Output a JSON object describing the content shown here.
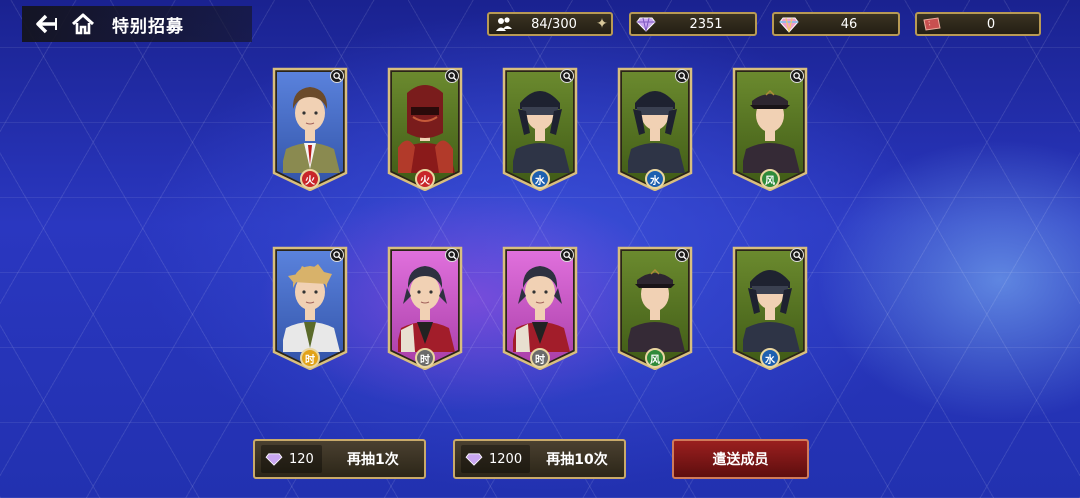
{
  "header": {
    "title": "特别招募"
  },
  "resources": [
    {
      "icon": "party-members-icon",
      "value": "84/300"
    },
    {
      "icon": "gem-icon",
      "value": "2351"
    },
    {
      "icon": "rainbow-gem-icon",
      "value": "46"
    },
    {
      "icon": "ticket-icon",
      "value": "0"
    }
  ],
  "cards": [
    {
      "element": "火",
      "bg": "blue",
      "badge_color": "#c8262a",
      "hair": "#6b4a2a",
      "outfit": "#8a8a50",
      "type": "officer"
    },
    {
      "element": "火",
      "bg": "green",
      "badge_color": "#c8262a",
      "hair": "#7a1c1c",
      "outfit": "#8a1a1a",
      "type": "armor"
    },
    {
      "element": "水",
      "bg": "green",
      "badge_color": "#1d5fb0",
      "hair": "#2a2f3c",
      "outfit": "#2e3446",
      "type": "helmet"
    },
    {
      "element": "水",
      "bg": "green",
      "badge_color": "#1d5fb0",
      "hair": "#2a2f3c",
      "outfit": "#2e3446",
      "type": "helmet"
    },
    {
      "element": "风",
      "bg": "green",
      "badge_color": "#2f8a3a",
      "hair": "#3a2e32",
      "outfit": "#352a36",
      "type": "cap"
    },
    {
      "element": "时",
      "bg": "blue",
      "badge_color": "#e2a318",
      "hair": "#d8b26a",
      "outfit": "#e8e8e8",
      "type": "blond"
    },
    {
      "element": "时",
      "bg": "pink",
      "badge_color": "#6a6a6a",
      "hair": "#2e3140",
      "outfit": "#a21d2a",
      "type": "hero"
    },
    {
      "element": "时",
      "bg": "pink",
      "badge_color": "#6a6a6a",
      "hair": "#2e3140",
      "outfit": "#a21d2a",
      "type": "hero"
    },
    {
      "element": "风",
      "bg": "green",
      "badge_color": "#2f8a3a",
      "hair": "#3a2e32",
      "outfit": "#352a36",
      "type": "cap"
    },
    {
      "element": "水",
      "bg": "green",
      "badge_color": "#1d5fb0",
      "hair": "#2a2f3c",
      "outfit": "#2e3446",
      "type": "helmet"
    }
  ],
  "buttons": {
    "draw_once": {
      "cost": "120",
      "label": "再抽1次"
    },
    "draw_ten": {
      "cost": "1200",
      "label": "再抽10次"
    },
    "dismiss": {
      "label": "遣送成员"
    }
  },
  "colors": {
    "gold_border": "#b89a55",
    "card_blue": "#4a6fc8",
    "card_green": "#5a7a2a",
    "card_pink": "#c94fc4",
    "dismiss_red": "#8c1a1a"
  }
}
